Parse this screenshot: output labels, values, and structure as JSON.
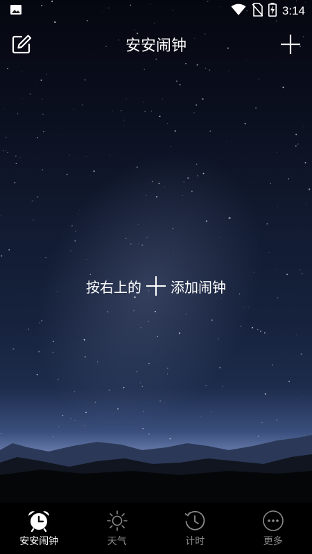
{
  "status_bar": {
    "time": "3:14",
    "left_icon": "image-icon",
    "right_icons": [
      "wifi-icon",
      "no-sim-icon",
      "battery-charging-icon"
    ]
  },
  "top_bar": {
    "title": "安安闹钟",
    "left_icon": "edit-icon",
    "right_icon": "plus-icon"
  },
  "empty_state": {
    "hint_prefix": "按右上的",
    "hint_suffix": "添加闹钟",
    "inline_icon": "plus-icon"
  },
  "tabs": [
    {
      "label": "安安闹钟",
      "icon": "alarm-clock-icon",
      "active": true
    },
    {
      "label": "天气",
      "icon": "sun-icon",
      "active": false
    },
    {
      "label": "计时",
      "icon": "timer-icon",
      "active": false
    },
    {
      "label": "更多",
      "icon": "more-icon",
      "active": false
    }
  ],
  "colors": {
    "sky_top": "#05070f",
    "horizon_glow": "#6a7fae",
    "tab_active": "#ffffff",
    "tab_inactive": "#8a8a8a",
    "tab_bar_bg": "#000000"
  }
}
